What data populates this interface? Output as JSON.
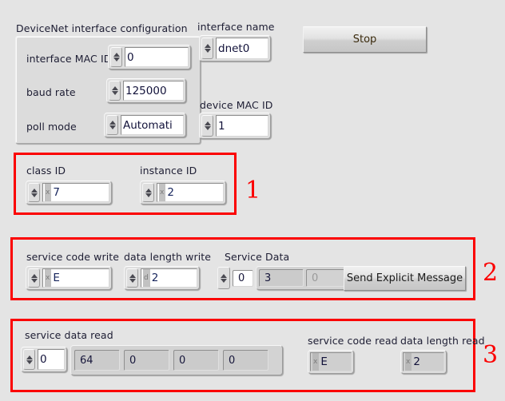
{
  "window": {
    "background": "#e4e4e4",
    "annotation_color": "#fb0000"
  },
  "config_cluster": {
    "title": "DeviceNet interface configuration",
    "rows": [
      {
        "label": "interface MAC ID",
        "value": "0"
      },
      {
        "label": "baud rate",
        "value": "125000"
      },
      {
        "label": "poll mode",
        "value": "Automati"
      }
    ]
  },
  "interface_name": {
    "label": "interface name",
    "value": "dnet0"
  },
  "device_mac_id": {
    "label": "device MAC ID",
    "value": "1"
  },
  "stop_button": {
    "label": "Stop"
  },
  "section1": {
    "number": "1",
    "class_id": {
      "label": "class ID",
      "radix": "x",
      "value": "7"
    },
    "instance_id": {
      "label": "instance ID",
      "radix": "x",
      "value": "2"
    }
  },
  "section2": {
    "number": "2",
    "service_code_write": {
      "label": "service code write",
      "radix": "x",
      "value": "E"
    },
    "data_length_write": {
      "label": "data length write",
      "radix": "d",
      "value": "2"
    },
    "service_data": {
      "label": "Service Data",
      "index": "0",
      "cells": [
        {
          "value": "3",
          "dim": false
        },
        {
          "value": "0",
          "dim": true
        }
      ]
    },
    "send_button": {
      "label": "Send Explicit Message"
    }
  },
  "section3": {
    "number": "3",
    "service_data_read": {
      "label": "service data read",
      "index": "0",
      "cells": [
        "64",
        "0",
        "0",
        "0"
      ]
    },
    "service_code_read": {
      "label": "service code read",
      "radix": "x",
      "value": "E"
    },
    "data_length_read": {
      "label": "data length read",
      "radix": "x",
      "value": "2"
    }
  }
}
